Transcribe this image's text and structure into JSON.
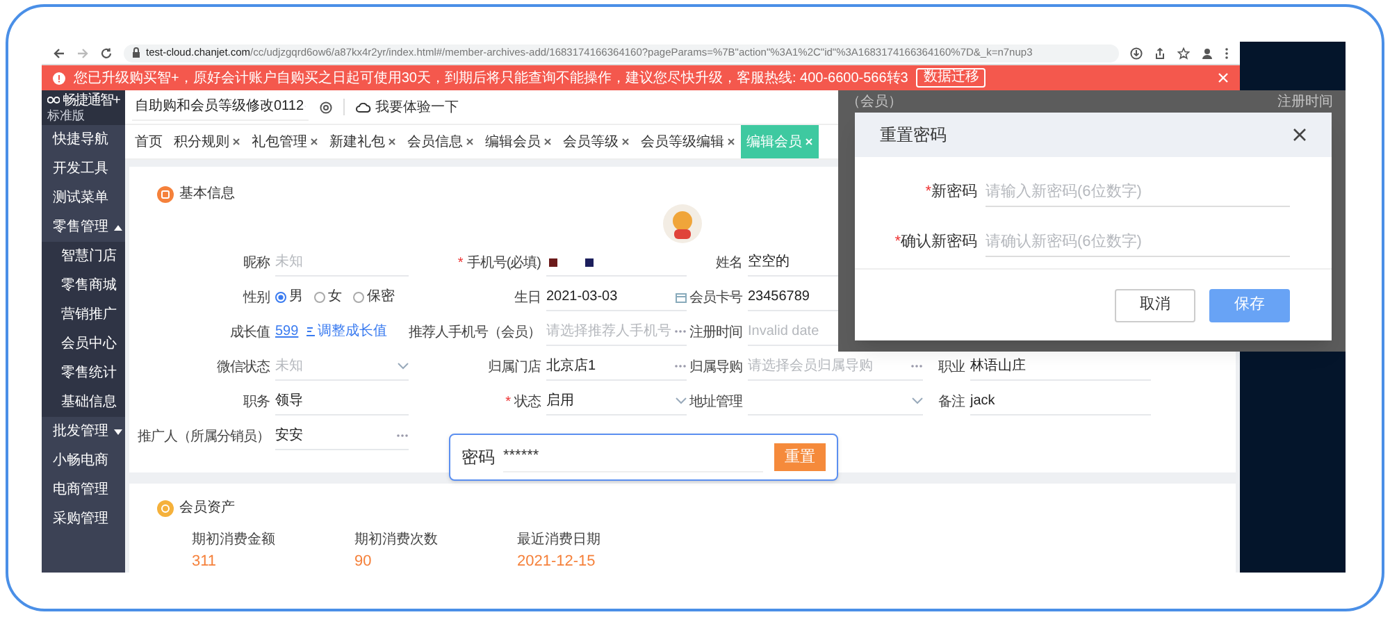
{
  "browser": {
    "url_host": "test-cloud.chanjet.com",
    "url_path": "/cc/udjzgqrd6ow6/a87kx4r2yr/index.html#/member-archives-add/1683174166364160?pageParams=%7B\"action\"%3A1%2C\"id\"%3A1683174166364160%7D&_k=n7nup3"
  },
  "banner": {
    "message": "您已升级购买智+，原好会计账户自购买之日起可使用30天，到期后将只能查询不能操作，建议您尽快升级，客服热线: 400-6600-566转3",
    "button": "数据迁移"
  },
  "logo": {
    "name": "畅捷通智+",
    "edition": "标准版"
  },
  "sidebar": {
    "items": [
      {
        "label": "快捷导航"
      },
      {
        "label": "开发工具"
      },
      {
        "label": "测试菜单"
      },
      {
        "label": "零售管理",
        "expanded": true,
        "children": [
          {
            "label": "智慧门店"
          },
          {
            "label": "零售商城"
          },
          {
            "label": "营销推广"
          },
          {
            "label": "会员中心"
          },
          {
            "label": "零售统计"
          },
          {
            "label": "基础信息"
          }
        ]
      },
      {
        "label": "批发管理",
        "expanded": false
      },
      {
        "label": "小畅电商"
      },
      {
        "label": "电商管理"
      },
      {
        "label": "采购管理"
      }
    ]
  },
  "header": {
    "account_select": "自助购和会员等级修改0112",
    "try_link": "我要体验一下"
  },
  "tabs": [
    {
      "label": "首页",
      "closable": false,
      "selected": false
    },
    {
      "label": "积分规则",
      "closable": true,
      "selected": false
    },
    {
      "label": "礼包管理",
      "closable": true,
      "selected": false
    },
    {
      "label": "新建礼包",
      "closable": true,
      "selected": false
    },
    {
      "label": "会员信息",
      "closable": true,
      "selected": false
    },
    {
      "label": "编辑会员",
      "closable": true,
      "selected": false
    },
    {
      "label": "会员等级",
      "closable": true,
      "selected": false
    },
    {
      "label": "会员等级编辑",
      "closable": true,
      "selected": false
    },
    {
      "label": "编辑会员",
      "closable": true,
      "selected": true
    }
  ],
  "basic_info": {
    "title": "基本信息",
    "rows": [
      {
        "cells": [
          {
            "label": "昵称",
            "kind": "input",
            "placeholder": "未知"
          },
          {
            "label": "手机号(必填)",
            "required_mark": "*",
            "kind": "redacted",
            "swatches": [
              {
                "color": "#6b1a1a"
              },
              {
                "color": "#1c1f5c"
              }
            ]
          },
          {
            "label": "姓名",
            "kind": "input",
            "value": "空空的"
          }
        ]
      },
      {
        "cells": [
          {
            "label": "性别",
            "kind": "radio",
            "options": [
              {
                "label": "男",
                "selected": true
              },
              {
                "label": "女",
                "selected": false
              },
              {
                "label": "保密",
                "selected": false
              }
            ]
          },
          {
            "label": "生日",
            "kind": "date",
            "value": "2021-03-03"
          },
          {
            "label": "会员卡号",
            "kind": "input",
            "value": "23456789"
          }
        ]
      },
      {
        "cells": [
          {
            "label": "成长值",
            "kind": "growth",
            "value": "599",
            "action": "调整成长值"
          },
          {
            "label": "推荐人手机号（会员）",
            "kind": "picker",
            "placeholder": "请选择推荐人手机号"
          },
          {
            "label": "注册时间",
            "kind": "input",
            "placeholder": "Invalid date"
          }
        ]
      },
      {
        "cells": [
          {
            "label": "微信状态",
            "kind": "select",
            "placeholder": "未知"
          },
          {
            "label": "归属门店",
            "kind": "picker",
            "value": "北京店1"
          },
          {
            "label": "归属导购",
            "kind": "picker",
            "placeholder": "请选择会员归属导购"
          },
          {
            "label": "职业",
            "kind": "input",
            "value": "林语山庄"
          }
        ]
      },
      {
        "cells": [
          {
            "label": "职务",
            "kind": "input",
            "value": "领导"
          },
          {
            "label": "状态",
            "required_mark": "*",
            "kind": "select",
            "value": "启用"
          },
          {
            "label": "地址管理",
            "kind": "select"
          },
          {
            "label": "备注",
            "kind": "input",
            "value": "jack"
          }
        ]
      },
      {
        "cells": [
          {
            "label": "推广人（所属分销员）",
            "kind": "picker",
            "value": "安安"
          }
        ]
      }
    ]
  },
  "assets": {
    "title": "会员资产",
    "items": [
      {
        "label": "期初消费金额",
        "value": "311"
      },
      {
        "label": "期初消费次数",
        "value": "90"
      },
      {
        "label": "最近消费日期",
        "value": "2021-12-15"
      }
    ]
  },
  "backdrop_texts": [
    "（会员）",
    "注册时间"
  ],
  "reset_dialog": {
    "title": "重置密码",
    "fields": [
      {
        "label": "新密码",
        "required_mark": "*",
        "placeholder": "请输入新密码(6位数字)"
      },
      {
        "label": "确认新密码",
        "required_mark": "*",
        "placeholder": "请确认新密码(6位数字)"
      }
    ],
    "buttons": [
      {
        "label": "取消",
        "kind": "secondary"
      },
      {
        "label": "保存",
        "kind": "primary"
      }
    ]
  },
  "password_callout": {
    "label": "密码",
    "value": "******",
    "button": "重置"
  }
}
